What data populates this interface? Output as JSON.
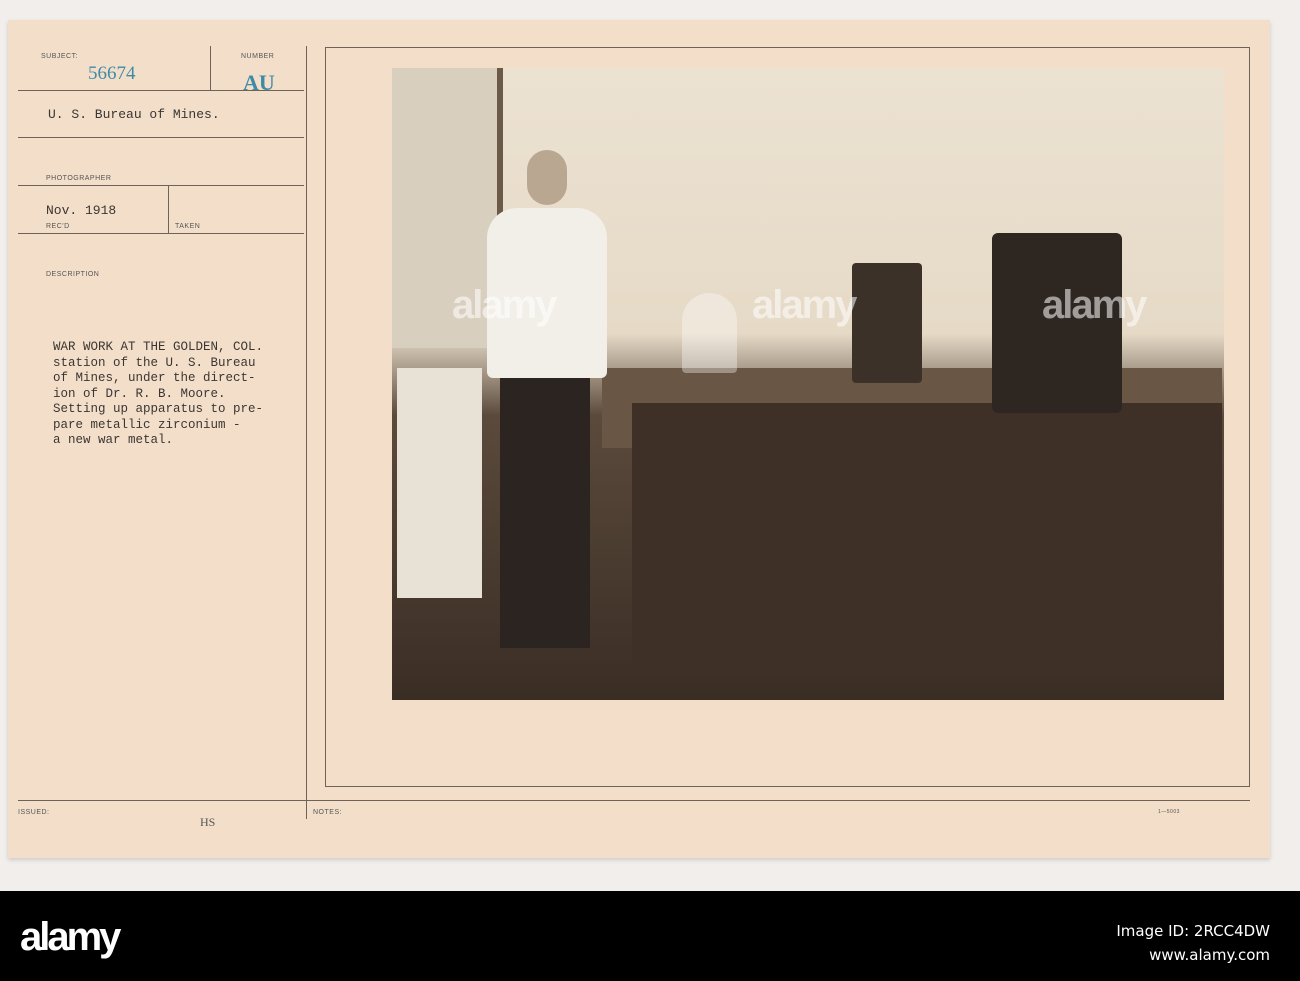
{
  "card": {
    "subject_label": "SUBJECT:",
    "subject_number": "56674",
    "number_label": "NUMBER",
    "number_value": "AU",
    "agency": "U. S. Bureau of Mines.",
    "photographer_label": "PHOTOGRAPHER",
    "date": "Nov. 1918",
    "recd_label": "REC'D",
    "taken_label": "TAKEN",
    "description_label": "DESCRIPTION",
    "description_lines": [
      "WAR WORK AT THE GOLDEN, COL.",
      "station of the U. S. Bureau",
      "of Mines, under the direct-",
      "ion of Dr. R. B. Moore.",
      "Setting up apparatus to pre-",
      "pare metallic zirconium -",
      "a new war metal."
    ],
    "issued_label": "ISSUED:",
    "issued_value": "HS",
    "notes_label": "NOTES:",
    "form_number": "1—5003"
  },
  "watermark": "alamy",
  "footer": {
    "logo": "alamy",
    "image_id": "Image ID: 2RCC4DW",
    "url": "www.alamy.com"
  }
}
